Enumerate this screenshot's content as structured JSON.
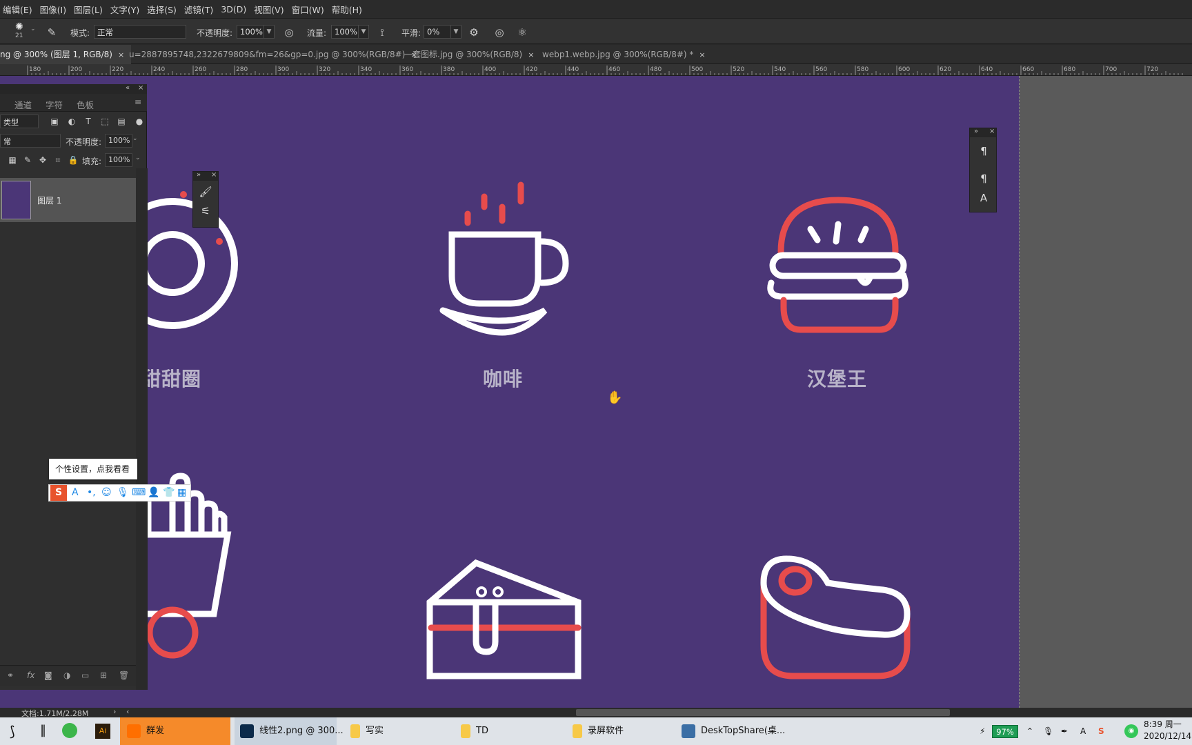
{
  "menu": [
    "编辑(E)",
    "图像(I)",
    "图层(L)",
    "文字(Y)",
    "选择(S)",
    "滤镜(T)",
    "3D(D)",
    "视图(V)",
    "窗口(W)",
    "帮助(H)"
  ],
  "options": {
    "brush_size": "21",
    "mode_label": "模式:",
    "mode_value": "正常",
    "opacity_label": "不透明度:",
    "opacity_value": "100%",
    "flow_label": "流量:",
    "flow_value": "100%",
    "smooth_label": "平滑:",
    "smooth_value": "0%"
  },
  "tabs": [
    {
      "label": "ng @ 300% (图层 1, RGB/8)",
      "close": "×"
    },
    {
      "label": "u=2887895748,2322679809&fm=26&gp=0.jpg @ 300%(RGB/8#)",
      "close": "×"
    },
    {
      "label": "一套图标.jpg @ 300%(RGB/8)",
      "close": "×"
    },
    {
      "label": "webp1.webp.jpg @ 300%(RGB/8#) *",
      "close": "×"
    }
  ],
  "ruler_ticks": [
    "180",
    "200",
    "220",
    "240",
    "260",
    "280",
    "300",
    "320",
    "340",
    "360",
    "380",
    "400",
    "420",
    "440",
    "460",
    "480",
    "500",
    "520",
    "540",
    "560",
    "580",
    "600",
    "620",
    "640",
    "660",
    "680",
    "700",
    "720"
  ],
  "layers_panel": {
    "tabs": [
      "通道",
      "字符",
      "色板"
    ],
    "filter_kind": "类型",
    "blend_mode": "常",
    "opacity_label": "不透明度:",
    "opacity_value": "100%",
    "fill_label": "填充:",
    "fill_value": "100%",
    "layer_name": "图层 1"
  },
  "canvas": {
    "background_color": "#4b3677",
    "labels": [
      "甜甜圈",
      "咖啡",
      "汉堡王"
    ]
  },
  "tooltip": "个性设置，点我看看",
  "status": {
    "doc_size": "文档:1.71M/2.28M"
  },
  "taskbar": {
    "items": [
      "群发",
      "线性2.png @ 300...",
      "写实",
      "TD",
      "录屏软件",
      "DeskTopShare(桌..."
    ],
    "battery": "97%",
    "time": "8:39 周一",
    "date": "2020/12/14"
  }
}
